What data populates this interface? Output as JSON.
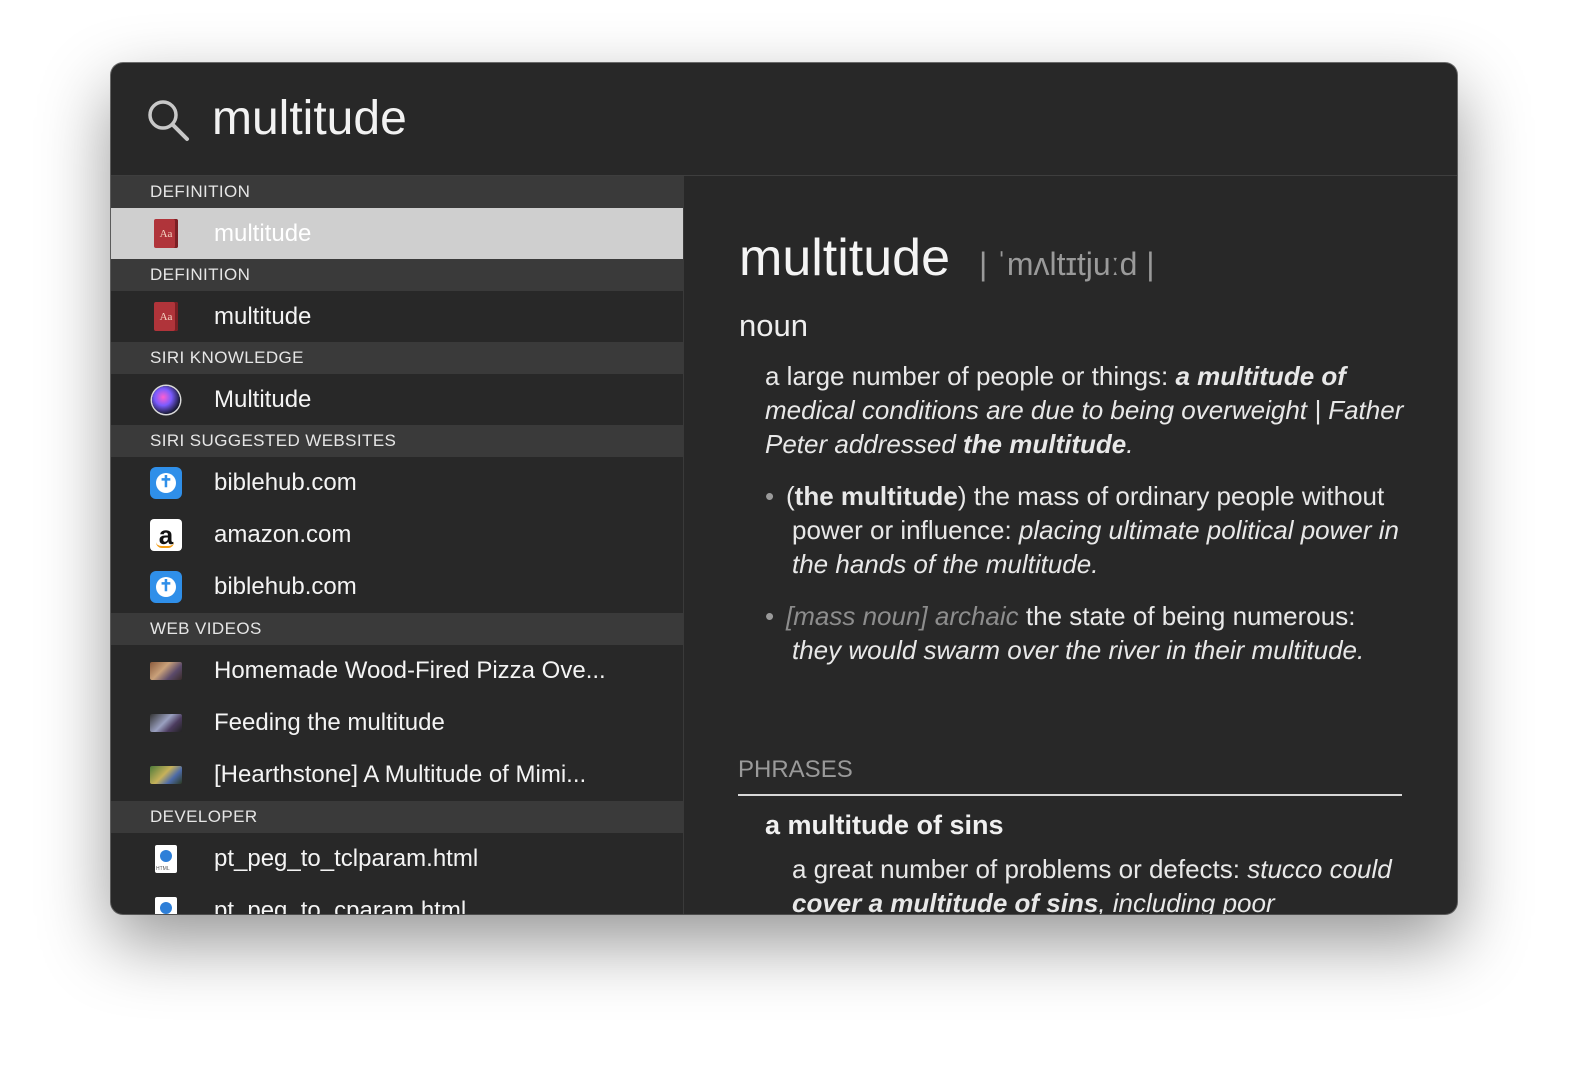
{
  "search": {
    "query": "multitude"
  },
  "results": {
    "sections": [
      {
        "header": "DEFINITION",
        "items": [
          {
            "label": "multitude",
            "icon": "dictionary-icon",
            "selected": true
          }
        ]
      },
      {
        "header": "DEFINITION",
        "items": [
          {
            "label": "multitude",
            "icon": "dictionary-icon"
          }
        ]
      },
      {
        "header": "SIRI KNOWLEDGE",
        "items": [
          {
            "label": "Multitude",
            "icon": "siri-icon"
          }
        ]
      },
      {
        "header": "SIRI SUGGESTED WEBSITES",
        "items": [
          {
            "label": "biblehub.com",
            "icon": "biblehub-icon"
          },
          {
            "label": "amazon.com",
            "icon": "amazon-icon"
          },
          {
            "label": "biblehub.com",
            "icon": "biblehub-icon"
          }
        ]
      },
      {
        "header": "WEB VIDEOS",
        "items": [
          {
            "label": "Homemade Wood-Fired Pizza Ove...",
            "icon": "video-thumbnail-icon"
          },
          {
            "label": "Feeding the multitude",
            "icon": "video-thumbnail-icon"
          },
          {
            "label": "[Hearthstone] A Multitude of Mimi...",
            "icon": "video-thumbnail-icon"
          }
        ]
      },
      {
        "header": "DEVELOPER",
        "items": [
          {
            "label": "pt_peg_to_tclparam.html",
            "icon": "html-file-icon"
          },
          {
            "label": "pt_peg_to_cparam.html",
            "icon": "html-file-icon"
          }
        ]
      }
    ]
  },
  "detail": {
    "headword": "multitude",
    "pronunciation": "| ˈmʌltɪtjuːd |",
    "part_of_speech": "noun",
    "definition_1": {
      "text": "a large number of people or things: ",
      "example_bold_1": "a multitude of",
      "example_1": " medical conditions are due to being overweight | Father Peter addressed ",
      "example_bold_2": "the multitude",
      "end": "."
    },
    "definition_2": {
      "open_paren": "(",
      "phrase": "the multitude",
      "close_paren": ")",
      "text": " the mass of ordinary people without power or influence: ",
      "example": "placing ultimate political power in the hands of the multitude",
      "end": "."
    },
    "definition_3": {
      "label": "[mass noun] archaic",
      "text": " the state of being numerous: ",
      "example": "they would swarm over the river in their multitude",
      "end": "."
    },
    "phrases_header": "PHRASES",
    "phrase_title": "a multitude of sins",
    "phrase_definition": {
      "text": "a great number of problems or defects: ",
      "example_1": "stucco could ",
      "example_bold": "cover a multitude of sins",
      "example_2": ", including poor"
    }
  }
}
